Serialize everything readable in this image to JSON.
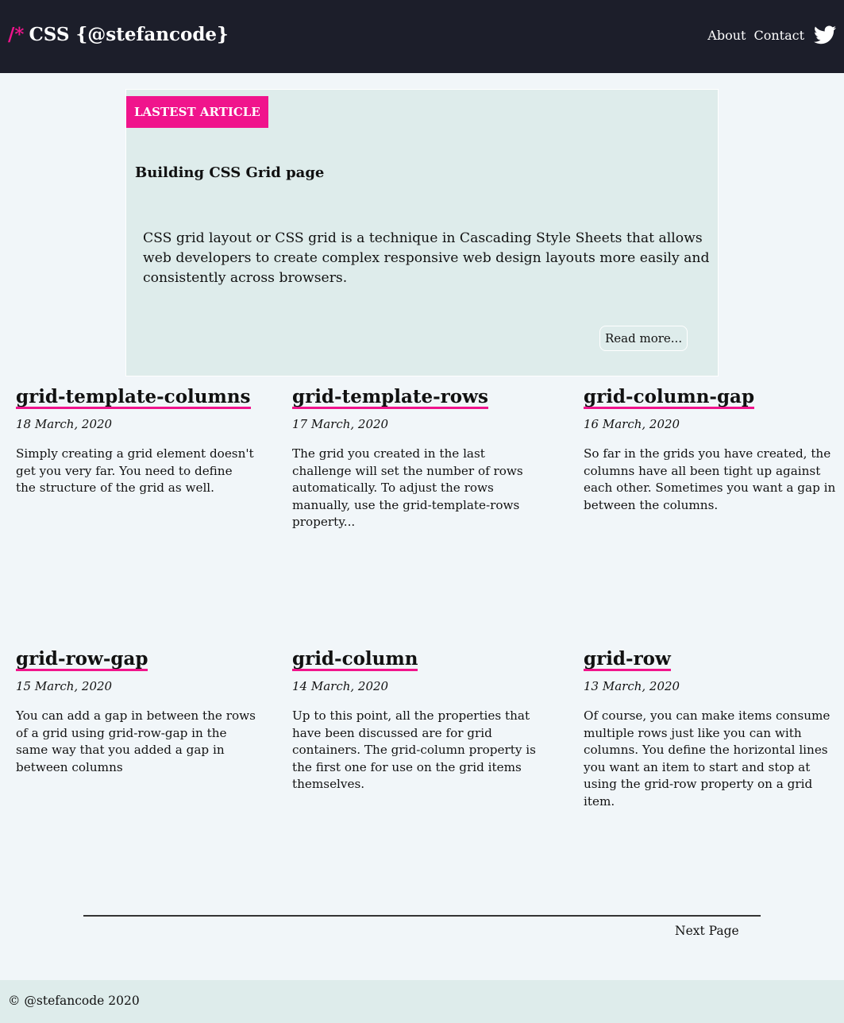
{
  "header": {
    "logo_slash": "/*",
    "logo_text": "CSS {@stefancode}",
    "nav": {
      "about": "About",
      "contact": "Contact"
    },
    "icons": {
      "twitter": "twitter-icon"
    }
  },
  "featured": {
    "badge": "LASTEST ARTICLE",
    "title": "Building CSS Grid page",
    "summary": "CSS grid layout or CSS grid is a technique in Cascading Style Sheets that allows web developers to create complex responsive web design layouts more easily and consistently across browsers.",
    "read_more": "Read more..."
  },
  "articles": [
    {
      "title": "grid-template-columns",
      "date": "18 March, 2020",
      "desc": "Simply creating a grid element doesn't get you very far. You need to define the structure of the grid as well."
    },
    {
      "title": "grid-template-rows",
      "date": "17 March, 2020",
      "desc": "The grid you created in the last challenge will set the number of rows automatically. To adjust the rows manually, use the grid-template-rows property..."
    },
    {
      "title": "grid-column-gap",
      "date": "16 March, 2020",
      "desc": "So far in the grids you have created, the columns have all been tight up against each other. Sometimes you want a gap in between the columns."
    },
    {
      "title": "grid-row-gap",
      "date": "15 March, 2020",
      "desc": "You can add a gap in between the rows of a grid using grid-row-gap in the same way that you added a gap in between columns"
    },
    {
      "title": "grid-column",
      "date": "14 March, 2020",
      "desc": "Up to this point, all the properties that have been discussed are for grid containers. The grid-column property is the first one for use on the grid items themselves."
    },
    {
      "title": "grid-row",
      "date": "13 March, 2020",
      "desc": "Of course, you can make items consume multiple rows just like you can with columns. You define the horizontal lines you want an item to start and stop at using the grid-row property on a grid item."
    }
  ],
  "pagination": {
    "next": "Next Page"
  },
  "footer": {
    "copyright": "© @stefancode 2020"
  },
  "colors": {
    "accent": "#f0148c",
    "header_bg": "#1c1e2a",
    "page_bg": "#f1f6f9",
    "panel_bg": "#deeceb"
  }
}
